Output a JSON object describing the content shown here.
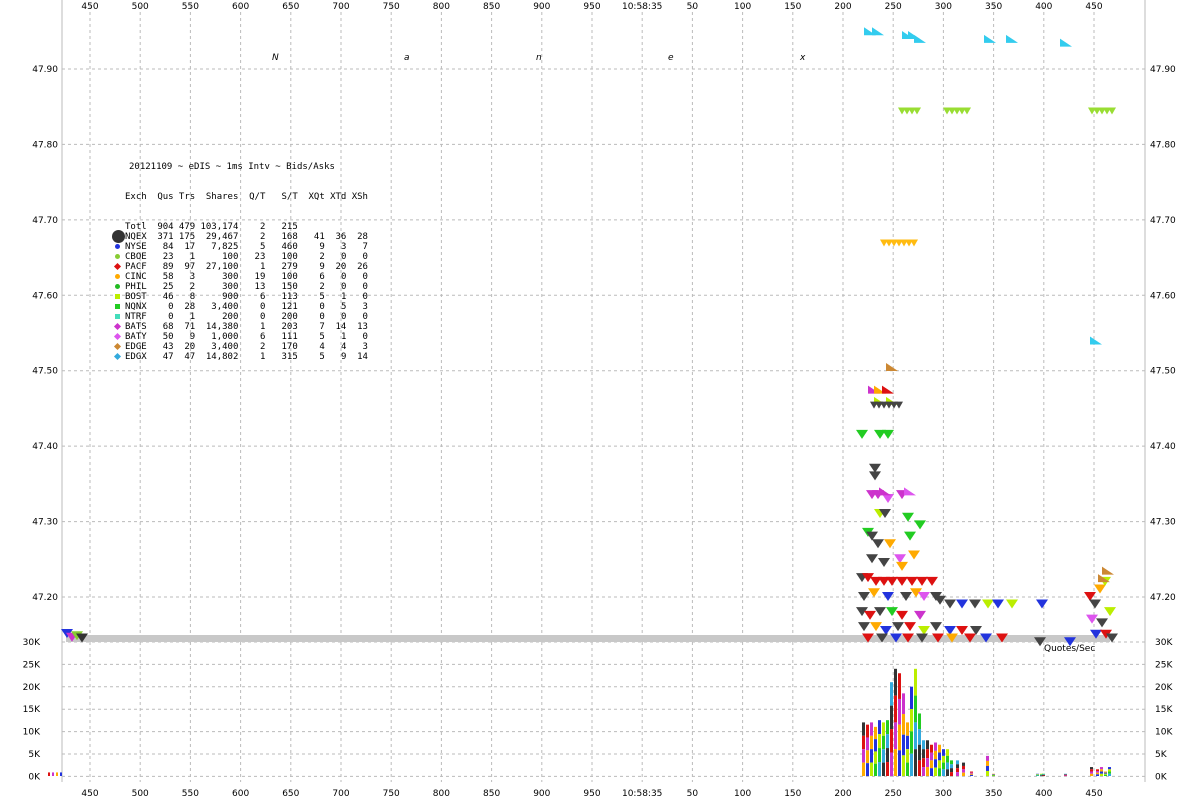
{
  "watermark": [
    "N",
    "a",
    "n",
    "e",
    "x"
  ],
  "center_time": "10:58:35",
  "quotes_label": "Quotes/Sec",
  "stats_title": "20121109 ~ eDIS ~ 1ms Intv ~ Bids/Asks",
  "stats_headers": [
    "Exch",
    "Qus",
    "Trs",
    "Shares",
    "Q/T",
    "S/T",
    "XQt",
    "XTd",
    "XSh"
  ],
  "stats_rows": [
    {
      "exch": "Totl",
      "qus": "904",
      "trs": "479",
      "shares": "103,174",
      "qt": "2",
      "st": "215",
      "xqt": "",
      "xtd": "",
      "xsh": "",
      "color": "",
      "marker": "none"
    },
    {
      "exch": "NQEX",
      "qus": "371",
      "trs": "175",
      "shares": "29,467",
      "qt": "2",
      "st": "168",
      "xqt": "41",
      "xtd": "36",
      "xsh": "28",
      "color": "#333333",
      "marker": "big"
    },
    {
      "exch": "NYSE",
      "qus": "84",
      "trs": "17",
      "shares": "7,825",
      "qt": "5",
      "st": "460",
      "xqt": "9",
      "xtd": "3",
      "xsh": "7",
      "color": "#2233dd",
      "marker": "circle"
    },
    {
      "exch": "CBOE",
      "qus": "23",
      "trs": "1",
      "shares": "100",
      "qt": "23",
      "st": "100",
      "xqt": "2",
      "xtd": "0",
      "xsh": "0",
      "color": "#88cc33",
      "marker": "circle"
    },
    {
      "exch": "PACF",
      "qus": "89",
      "trs": "97",
      "shares": "27,100",
      "qt": "1",
      "st": "279",
      "xqt": "9",
      "xtd": "20",
      "xsh": "26",
      "color": "#dd1111",
      "marker": "diamond"
    },
    {
      "exch": "CINC",
      "qus": "58",
      "trs": "3",
      "shares": "300",
      "qt": "19",
      "st": "100",
      "xqt": "6",
      "xtd": "0",
      "xsh": "0",
      "color": "#ffaa00",
      "marker": "circle"
    },
    {
      "exch": "PHIL",
      "qus": "25",
      "trs": "2",
      "shares": "300",
      "qt": "13",
      "st": "150",
      "xqt": "2",
      "xtd": "0",
      "xsh": "0",
      "color": "#22bb22",
      "marker": "circle"
    },
    {
      "exch": "BOST",
      "qus": "46",
      "trs": "8",
      "shares": "900",
      "qt": "6",
      "st": "113",
      "xqt": "5",
      "xtd": "1",
      "xsh": "0",
      "color": "#bbee00",
      "marker": "square"
    },
    {
      "exch": "NQNX",
      "qus": "0",
      "trs": "28",
      "shares": "3,400",
      "qt": "0",
      "st": "121",
      "xqt": "0",
      "xtd": "5",
      "xsh": "3",
      "color": "#22cc22",
      "marker": "square"
    },
    {
      "exch": "NTRF",
      "qus": "0",
      "trs": "1",
      "shares": "200",
      "qt": "0",
      "st": "200",
      "xqt": "0",
      "xtd": "0",
      "xsh": "0",
      "color": "#44ddbb",
      "marker": "square"
    },
    {
      "exch": "BATS",
      "qus": "68",
      "trs": "71",
      "shares": "14,380",
      "qt": "1",
      "st": "203",
      "xqt": "7",
      "xtd": "14",
      "xsh": "13",
      "color": "#cc33cc",
      "marker": "diamond"
    },
    {
      "exch": "BATY",
      "qus": "50",
      "trs": "9",
      "shares": "1,000",
      "qt": "6",
      "st": "111",
      "xqt": "5",
      "xtd": "1",
      "xsh": "0",
      "color": "#dd55ee",
      "marker": "diamond"
    },
    {
      "exch": "EDGE",
      "qus": "43",
      "trs": "20",
      "shares": "3,400",
      "qt": "2",
      "st": "170",
      "xqt": "4",
      "xtd": "4",
      "xsh": "3",
      "color": "#cc8833",
      "marker": "diamond"
    },
    {
      "exch": "EDGX",
      "qus": "47",
      "trs": "47",
      "shares": "14,802",
      "qt": "1",
      "st": "315",
      "xqt": "5",
      "xtd": "9",
      "xsh": "14",
      "color": "#33aadd",
      "marker": "diamond"
    }
  ],
  "chart_data": [
    {
      "type": "scatter",
      "title": "",
      "x_ticks": [
        "450",
        "500",
        "550",
        "600",
        "650",
        "700",
        "750",
        "800",
        "850",
        "900",
        "950",
        "10:58:35",
        "50",
        "100",
        "150",
        "200",
        "250",
        "300",
        "350",
        "400",
        "450"
      ],
      "y_ticks": [
        47.9,
        47.8,
        47.7,
        47.6,
        47.5,
        47.4,
        47.3,
        47.2
      ],
      "ylim": [
        47.135,
        47.97
      ],
      "grid": true,
      "quote_markers": [
        {
          "t": -573,
          "y": 47.151,
          "color": "#2233dd"
        },
        {
          "t": -568,
          "y": 47.146,
          "color": "#cc33cc"
        },
        {
          "t": -563,
          "y": 47.148,
          "color": "#88cc33"
        },
        {
          "t": -558,
          "y": 47.145,
          "color": "#333333"
        },
        {
          "t": 222,
          "y": 47.415,
          "color": "#22cc22"
        },
        {
          "t": 240,
          "y": 47.415,
          "color": "#22cc22"
        },
        {
          "t": 248,
          "y": 47.415,
          "color": "#22cc22"
        },
        {
          "t": 235,
          "y": 47.37,
          "color": "#444444"
        },
        {
          "t": 235,
          "y": 47.36,
          "color": "#444444"
        },
        {
          "t": 232,
          "y": 47.335,
          "color": "#cc33cc"
        },
        {
          "t": 238,
          "y": 47.335,
          "color": "#cc33cc"
        },
        {
          "t": 248,
          "y": 47.33,
          "color": "#dd55ee"
        },
        {
          "t": 262,
          "y": 47.335,
          "color": "#cc33cc"
        },
        {
          "t": 240,
          "y": 47.31,
          "color": "#bbee00"
        },
        {
          "t": 245,
          "y": 47.31,
          "color": "#444444"
        },
        {
          "t": 268,
          "y": 47.305,
          "color": "#22cc22"
        },
        {
          "t": 280,
          "y": 47.295,
          "color": "#22cc22"
        },
        {
          "t": 228,
          "y": 47.285,
          "color": "#22cc22"
        },
        {
          "t": 232,
          "y": 47.28,
          "color": "#444444"
        },
        {
          "t": 238,
          "y": 47.27,
          "color": "#444444"
        },
        {
          "t": 250,
          "y": 47.27,
          "color": "#ffaa00"
        },
        {
          "t": 270,
          "y": 47.28,
          "color": "#22cc22"
        },
        {
          "t": 274,
          "y": 47.255,
          "color": "#ffaa00"
        },
        {
          "t": 232,
          "y": 47.25,
          "color": "#444444"
        },
        {
          "t": 244,
          "y": 47.245,
          "color": "#444444"
        },
        {
          "t": 260,
          "y": 47.25,
          "color": "#dd55ee"
        },
        {
          "t": 262,
          "y": 47.24,
          "color": "#ffaa00"
        },
        {
          "t": 222,
          "y": 47.225,
          "color": "#444444"
        },
        {
          "t": 228,
          "y": 47.225,
          "color": "#dd1111"
        },
        {
          "t": 236,
          "y": 47.22,
          "color": "#dd1111"
        },
        {
          "t": 244,
          "y": 47.22,
          "color": "#dd1111"
        },
        {
          "t": 252,
          "y": 47.22,
          "color": "#dd1111"
        },
        {
          "t": 262,
          "y": 47.22,
          "color": "#dd1111"
        },
        {
          "t": 272,
          "y": 47.22,
          "color": "#dd1111"
        },
        {
          "t": 282,
          "y": 47.22,
          "color": "#dd1111"
        },
        {
          "t": 292,
          "y": 47.22,
          "color": "#dd1111"
        },
        {
          "t": 224,
          "y": 47.2,
          "color": "#444444"
        },
        {
          "t": 234,
          "y": 47.205,
          "color": "#ffaa00"
        },
        {
          "t": 248,
          "y": 47.2,
          "color": "#2233dd"
        },
        {
          "t": 266,
          "y": 47.2,
          "color": "#444444"
        },
        {
          "t": 276,
          "y": 47.205,
          "color": "#ffaa00"
        },
        {
          "t": 284,
          "y": 47.2,
          "color": "#dd55ee"
        },
        {
          "t": 296,
          "y": 47.2,
          "color": "#444444"
        },
        {
          "t": 300,
          "y": 47.195,
          "color": "#444444"
        },
        {
          "t": 310,
          "y": 47.19,
          "color": "#444444"
        },
        {
          "t": 322,
          "y": 47.19,
          "color": "#2233dd"
        },
        {
          "t": 335,
          "y": 47.19,
          "color": "#444444"
        },
        {
          "t": 348,
          "y": 47.19,
          "color": "#bbee00"
        },
        {
          "t": 358,
          "y": 47.19,
          "color": "#2233dd"
        },
        {
          "t": 372,
          "y": 47.19,
          "color": "#bbee00"
        },
        {
          "t": 402,
          "y": 47.19,
          "color": "#2233dd"
        },
        {
          "t": 222,
          "y": 47.18,
          "color": "#444444"
        },
        {
          "t": 230,
          "y": 47.175,
          "color": "#dd1111"
        },
        {
          "t": 240,
          "y": 47.18,
          "color": "#444444"
        },
        {
          "t": 252,
          "y": 47.18,
          "color": "#22cc22"
        },
        {
          "t": 262,
          "y": 47.175,
          "color": "#dd1111"
        },
        {
          "t": 280,
          "y": 47.175,
          "color": "#cc33cc"
        },
        {
          "t": 224,
          "y": 47.16,
          "color": "#444444"
        },
        {
          "t": 236,
          "y": 47.16,
          "color": "#ffaa00"
        },
        {
          "t": 246,
          "y": 47.155,
          "color": "#2233dd"
        },
        {
          "t": 258,
          "y": 47.16,
          "color": "#444444"
        },
        {
          "t": 270,
          "y": 47.16,
          "color": "#dd1111"
        },
        {
          "t": 284,
          "y": 47.155,
          "color": "#bbee00"
        },
        {
          "t": 296,
          "y": 47.16,
          "color": "#444444"
        },
        {
          "t": 310,
          "y": 47.155,
          "color": "#2233dd"
        },
        {
          "t": 322,
          "y": 47.155,
          "color": "#dd1111"
        },
        {
          "t": 336,
          "y": 47.155,
          "color": "#444444"
        },
        {
          "t": 228,
          "y": 47.145,
          "color": "#dd1111"
        },
        {
          "t": 242,
          "y": 47.145,
          "color": "#444444"
        },
        {
          "t": 256,
          "y": 47.145,
          "color": "#2233dd"
        },
        {
          "t": 268,
          "y": 47.145,
          "color": "#dd1111"
        },
        {
          "t": 282,
          "y": 47.145,
          "color": "#444444"
        },
        {
          "t": 298,
          "y": 47.145,
          "color": "#dd1111"
        },
        {
          "t": 312,
          "y": 47.145,
          "color": "#ffaa00"
        },
        {
          "t": 330,
          "y": 47.145,
          "color": "#dd1111"
        },
        {
          "t": 346,
          "y": 47.145,
          "color": "#2233dd"
        },
        {
          "t": 362,
          "y": 47.145,
          "color": "#dd1111"
        },
        {
          "t": 400,
          "y": 47.14,
          "color": "#444444"
        },
        {
          "t": 430,
          "y": 47.14,
          "color": "#2233dd"
        },
        {
          "t": 450,
          "y": 47.2,
          "color": "#dd1111"
        },
        {
          "t": 455,
          "y": 47.19,
          "color": "#444444"
        },
        {
          "t": 460,
          "y": 47.21,
          "color": "#ffaa00"
        },
        {
          "t": 465,
          "y": 47.22,
          "color": "#bbee00"
        },
        {
          "t": 452,
          "y": 47.17,
          "color": "#dd55ee"
        },
        {
          "t": 462,
          "y": 47.165,
          "color": "#444444"
        },
        {
          "t": 470,
          "y": 47.18,
          "color": "#bbee00"
        },
        {
          "t": 456,
          "y": 47.15,
          "color": "#2233dd"
        },
        {
          "t": 466,
          "y": 47.15,
          "color": "#dd1111"
        },
        {
          "t": 472,
          "y": 47.145,
          "color": "#444444"
        }
      ],
      "up_markers": [
        {
          "t": 234,
          "y": 47.475,
          "color": "#cc33cc"
        },
        {
          "t": 240,
          "y": 47.475,
          "color": "#ffaa00"
        },
        {
          "t": 248,
          "y": 47.475,
          "color": "#dd1111"
        },
        {
          "t": 252,
          "y": 47.505,
          "color": "#cc8833"
        },
        {
          "t": 240,
          "y": 47.46,
          "color": "#bbee00"
        },
        {
          "t": 252,
          "y": 47.46,
          "color": "#bbee00"
        },
        {
          "t": 245,
          "y": 47.34,
          "color": "#cc33cc"
        },
        {
          "t": 270,
          "y": 47.34,
          "color": "#dd55ee"
        },
        {
          "t": 230,
          "y": 47.95,
          "color": "#33ccee"
        },
        {
          "t": 238,
          "y": 47.95,
          "color": "#33ccee"
        },
        {
          "t": 268,
          "y": 47.945,
          "color": "#33ccee"
        },
        {
          "t": 274,
          "y": 47.945,
          "color": "#33ccee"
        },
        {
          "t": 280,
          "y": 47.94,
          "color": "#33ccee"
        },
        {
          "t": 350,
          "y": 47.94,
          "color": "#33ccee"
        },
        {
          "t": 372,
          "y": 47.94,
          "color": "#33ccee"
        },
        {
          "t": 426,
          "y": 47.935,
          "color": "#33ccee"
        },
        {
          "t": 456,
          "y": 47.54,
          "color": "#33ccee"
        },
        {
          "t": 468,
          "y": 47.235,
          "color": "#cc8833"
        },
        {
          "t": 464,
          "y": 47.225,
          "color": "#cc8833"
        }
      ],
      "ask_lines": [
        {
          "t0": 262,
          "t1": 280,
          "y": 47.845,
          "color": "#99dd33"
        },
        {
          "t0": 307,
          "t1": 327,
          "y": 47.845,
          "color": "#99dd33"
        },
        {
          "t0": 452,
          "t1": 476,
          "y": 47.845,
          "color": "#99dd33"
        },
        {
          "t0": 244,
          "t1": 278,
          "y": 47.67,
          "color": "#ffbb11"
        },
        {
          "t0": 234,
          "t1": 260,
          "y": 47.455,
          "color": "#444444"
        }
      ]
    },
    {
      "type": "bar",
      "title": "",
      "ylabel": "Quotes/Sec",
      "y_ticks": [
        "30K",
        "25K",
        "20K",
        "15K",
        "10K",
        "5K",
        "0K"
      ],
      "ylim": [
        0,
        30000
      ],
      "baseline_band": {
        "t0": -730,
        "t1": 470,
        "value": 30000
      },
      "x": [
        222,
        226,
        230,
        234,
        238,
        242,
        246,
        250,
        254,
        258,
        262,
        266,
        270,
        274,
        278,
        282,
        286,
        290,
        294,
        298,
        302,
        306,
        310,
        316,
        322,
        330,
        346,
        352,
        396,
        400,
        402,
        424,
        450,
        456,
        460,
        464,
        468
      ],
      "values": [
        12000,
        11500,
        12000,
        11000,
        12500,
        12000,
        12500,
        21000,
        24000,
        23000,
        18500,
        12000,
        20000,
        24000,
        14000,
        8000,
        8000,
        7000,
        7500,
        7000,
        6000,
        6000,
        3500,
        3500,
        3000,
        1000,
        4500,
        500,
        500,
        500,
        500,
        500,
        2000,
        1500,
        2000,
        1000,
        2000
      ]
    }
  ]
}
